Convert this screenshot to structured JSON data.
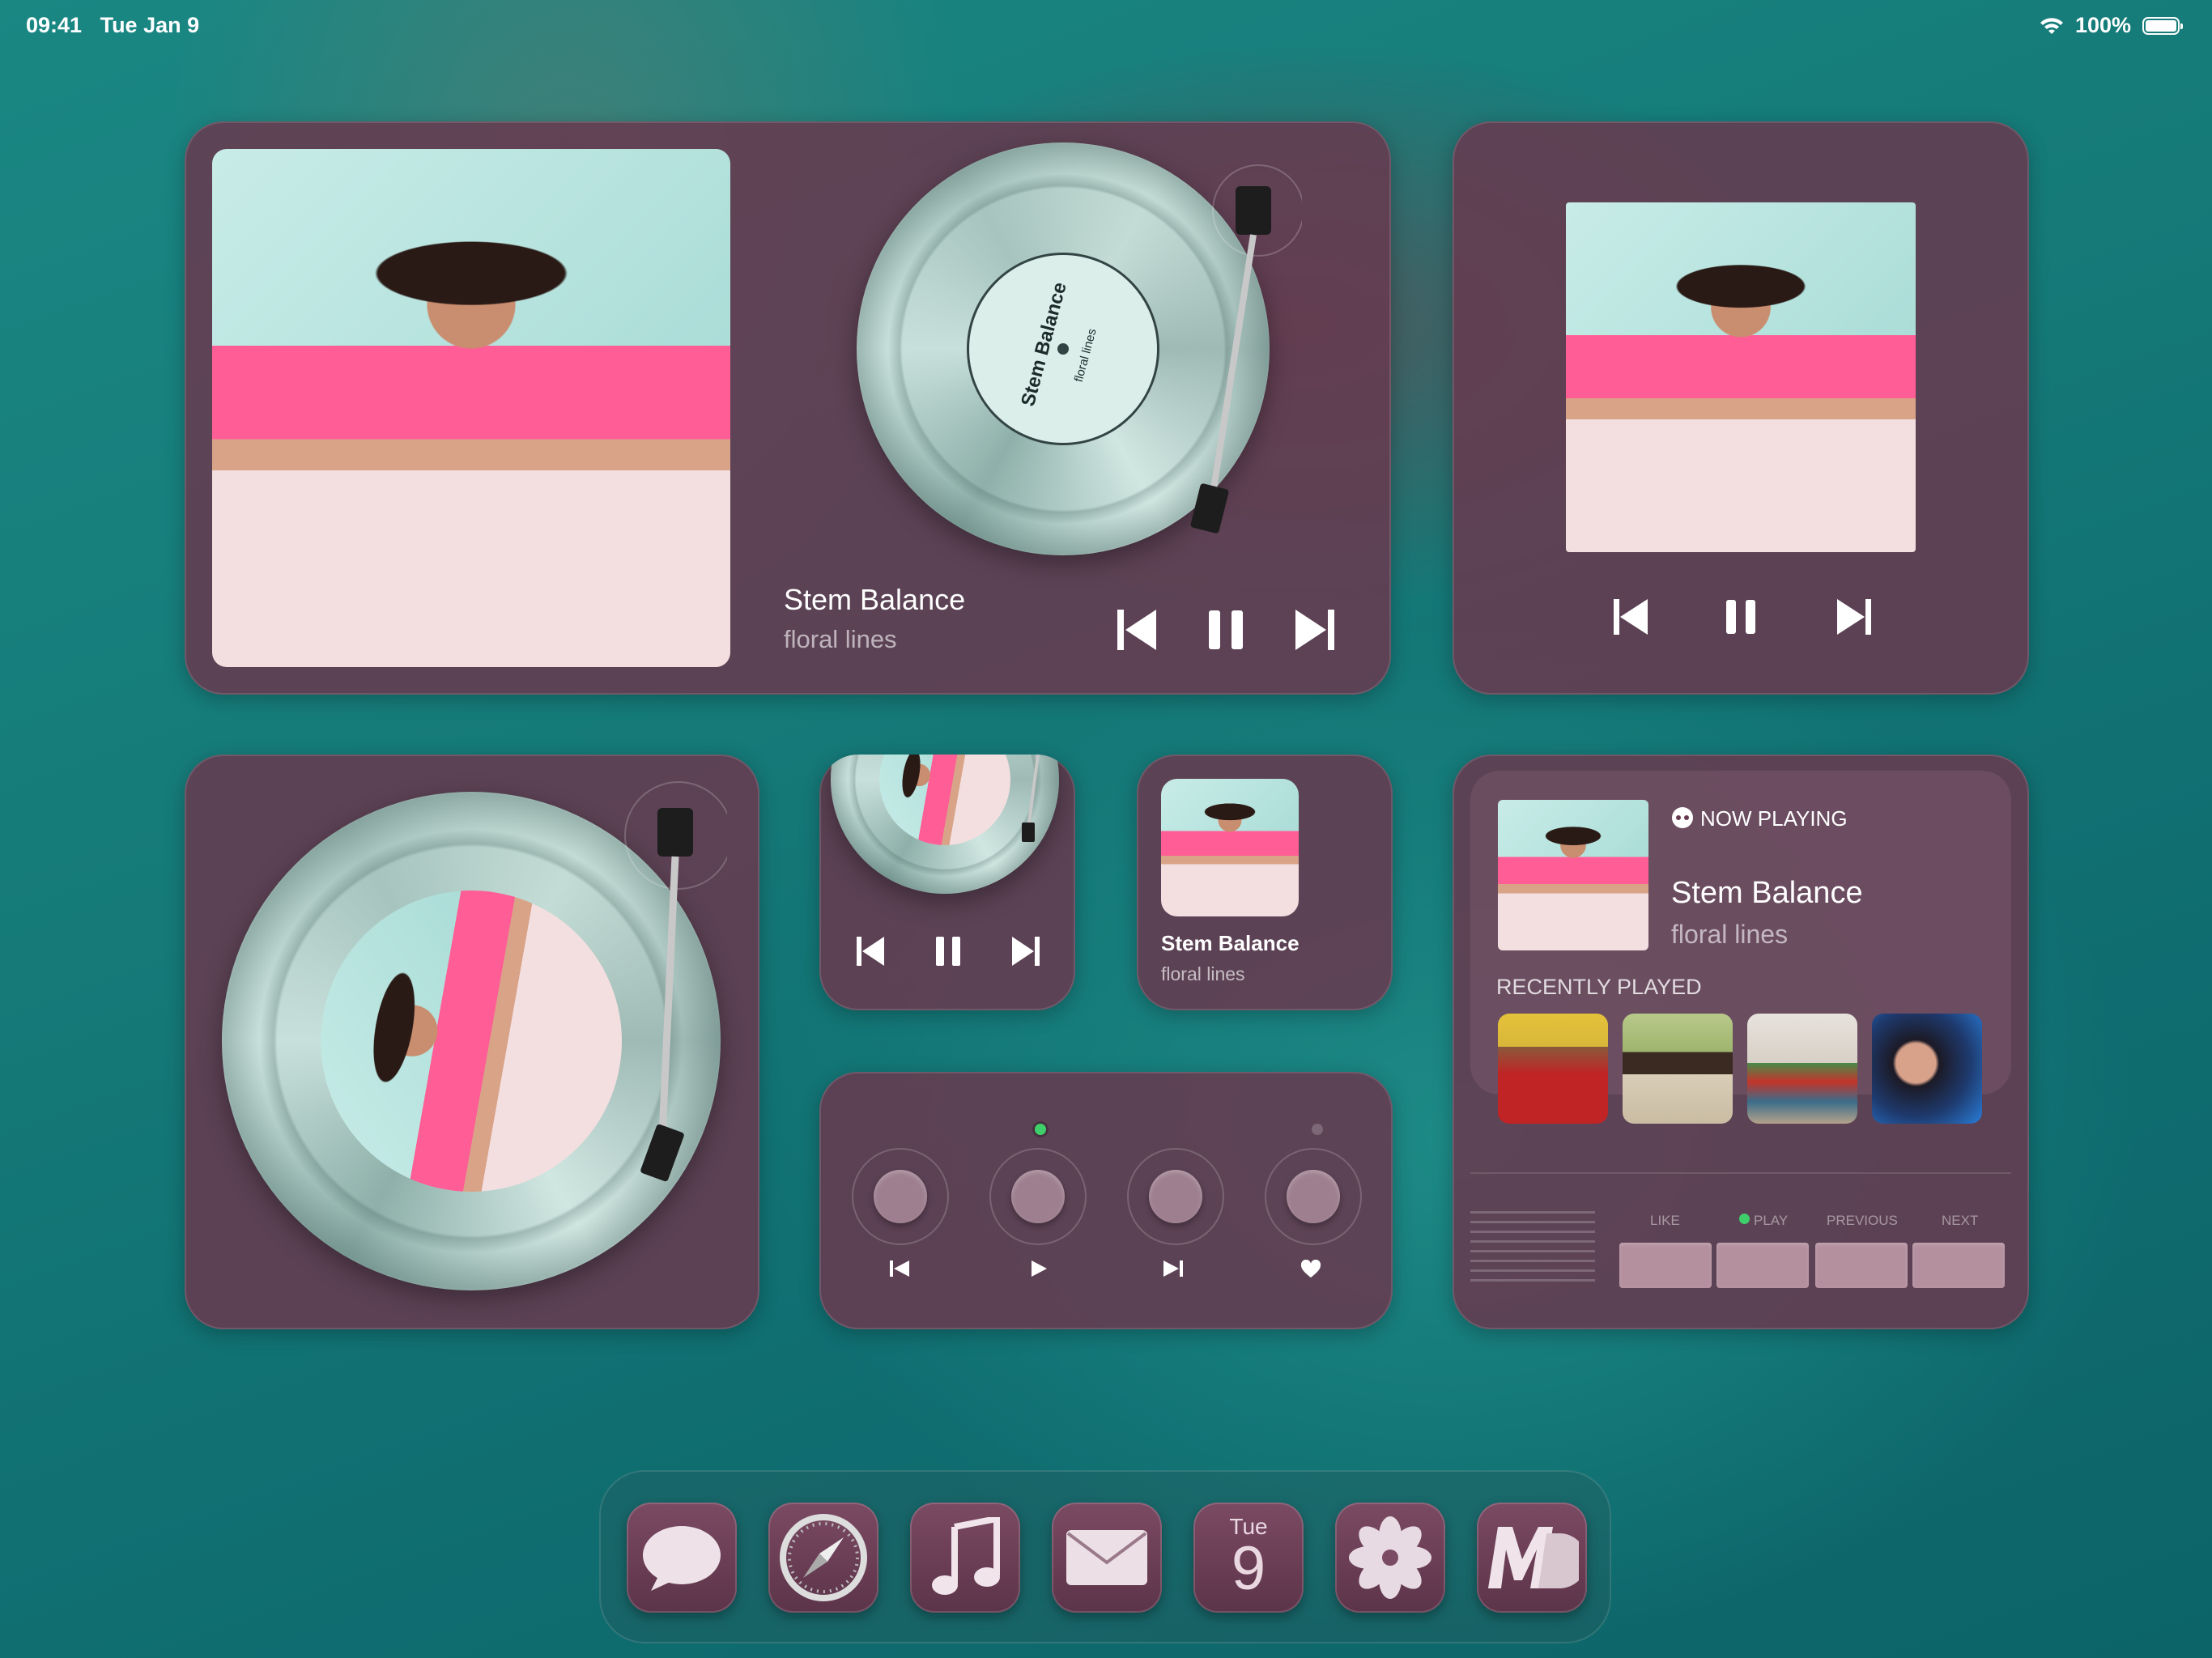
{
  "status_bar": {
    "time": "09:41",
    "date": "Tue Jan 9",
    "battery": "100%",
    "battery_level": 1.0
  },
  "track": {
    "title": "Stem Balance",
    "artist": "floral lines"
  },
  "record_label": {
    "title": "Stem Balance",
    "artist": "floral lines"
  },
  "now_playing_widget": {
    "header": "NOW PLAYING",
    "title": "Stem Balance",
    "artist": "floral lines",
    "recent_header": "RECENTLY PLAYED"
  },
  "control_widget": {
    "labels": {
      "like": "LIKE",
      "play": "PLAY",
      "previous": "PREVIOUS",
      "next": "NEXT"
    }
  },
  "dock": {
    "calendar_day": "Tue",
    "calendar_date": "9",
    "apps": [
      "messages-icon",
      "safari-icon",
      "music-icon",
      "mail-icon",
      "calendar-icon",
      "photos-icon",
      "md-icon"
    ]
  },
  "colors": {
    "widget_bg": "#663a50",
    "accent_green": "#3ecf6a",
    "wallpaper": "#157a78",
    "pink": "#ff5d96"
  }
}
